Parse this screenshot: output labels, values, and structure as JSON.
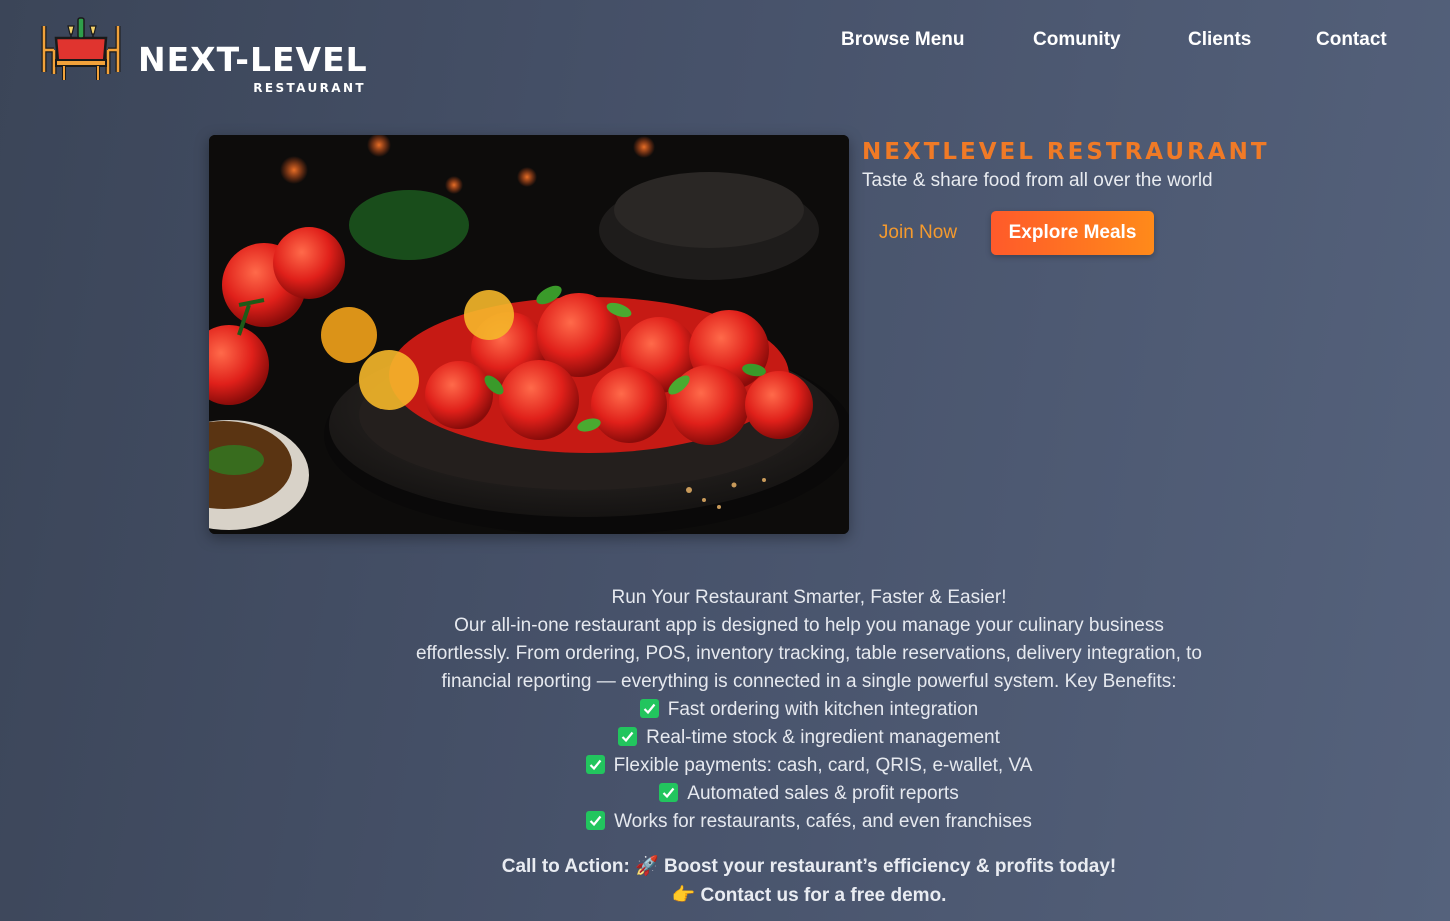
{
  "header": {
    "logo_name": "NEXT-LEVEL",
    "logo_sub": "RESTAURANT",
    "nav": [
      "Browse Menu",
      "Comunity",
      "Clients",
      "Contact"
    ]
  },
  "hero": {
    "title": "NEXTLEVEL RESTRAURANT",
    "subtitle": "Taste & share food from all over the world",
    "join_label": "Join Now",
    "explore_label": "Explore Meals"
  },
  "description": {
    "headline": "Run Your Restaurant Smarter, Faster & Easier!",
    "body": "Our all-in-one restaurant app is designed to help you manage your culinary business effortlessly. From ordering, POS, inventory tracking, table reservations, delivery integration, to financial reporting — everything is connected in a single powerful system. Key Benefits:",
    "benefits": [
      "Fast ordering with kitchen integration",
      "Real-time stock & ingredient management",
      "Flexible payments: cash, card, QRIS, e-wallet, VA",
      "Automated sales & profit reports",
      "Works for restaurants, cafés, and even franchises"
    ]
  },
  "cta": {
    "label": "Call to Action:",
    "line1": "Boost your restaurant’s efficiency & profits today!",
    "line2": "Contact us for a free demo.",
    "rocket_icon": "🚀",
    "pointing_icon": "👉"
  },
  "colors": {
    "accent": "#f07a26",
    "button_start": "#ff5a2a",
    "button_end": "#ff8a1a",
    "check": "#22c55e"
  }
}
